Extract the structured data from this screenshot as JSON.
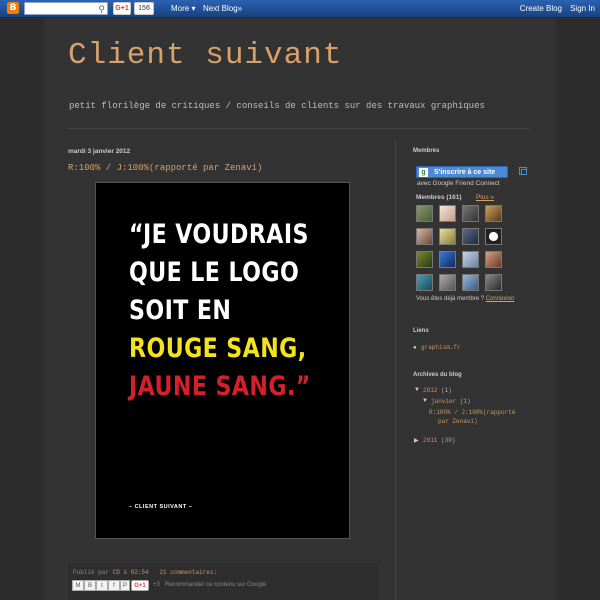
{
  "navbar": {
    "search_placeholder": "",
    "gplus": "G+1",
    "count": "156",
    "more": "More ▾",
    "next_blog": "Next Blog»",
    "create_blog": "Create Blog",
    "sign_in": "Sign In"
  },
  "blog": {
    "title": "Client suivant",
    "tagline": "petit florilège de critiques / conseils de clients sur des travaux graphiques"
  },
  "post": {
    "date": "mardi 3 janvier 2012",
    "title": "R:100% / J:100%(rapporté par Zenavi)",
    "poster_lines": [
      "“JE VOUDRAIS",
      "QUE LE LOGO",
      "SOIT EN",
      "ROUGE SANG,",
      "JAUNE SANG.”"
    ],
    "poster_signature": "– CLIENT SUIVANT –",
    "poster_colors": {
      "white": "#ffffff",
      "yellow": "#f4e21a",
      "red": "#d3202b"
    },
    "footer_prefix": "Publié par ",
    "footer_author": "CD",
    "footer_at": " à ",
    "footer_time": "02:54",
    "footer_comments": "21 commentaires:",
    "share_gplus": "G+1",
    "share_count": "+3",
    "share_recommend": "Recommander ce contenu sur Google"
  },
  "sidebar": {
    "members_heading": "Membres",
    "follow_label": "S'inscrire à ce site",
    "gfc_text": "avec Google Friend Connect",
    "members_count": "Membres (161)",
    "plus_link": "Plus »",
    "already_member": "Vous êtes déjà membre ? ",
    "connexion": "Connexion",
    "links_heading": "Liens",
    "link_1": "graphism.fr",
    "archive_heading": "Archives du blog",
    "archive_2012": "2012",
    "archive_2012_count": " (1)",
    "archive_jan": "janvier",
    "archive_jan_count": " (1)",
    "archive_post_1": "R:100% / J:100%(rapporté",
    "archive_post_2": "par Zenavi)",
    "archive_2011": "2011",
    "archive_2011_count": " (30)"
  },
  "colors": {
    "accent": "#d8a06a",
    "background": "#2c2c2c",
    "panel": "#333333",
    "navbar": "#1a4a8b"
  }
}
